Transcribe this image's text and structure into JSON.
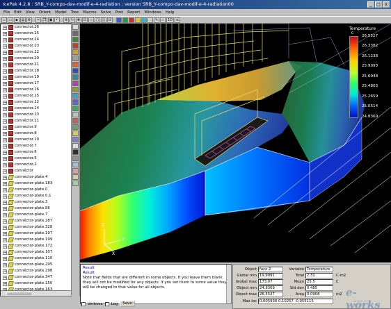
{
  "window": {
    "title": "IcePak 4.2.8 : SRB_Y-compo-dav-modif-e-4-radiation ; version SRB_Y-compo-dav-modif-e-4-radiation00",
    "minimize": "_",
    "maximize": "□",
    "close": "x"
  },
  "menu": [
    "File",
    "Edit",
    "View",
    "Orient",
    "Model",
    "Tree",
    "Macros",
    "Solve",
    "Post",
    "Report",
    "Windows",
    "Help"
  ],
  "toolbar": {
    "icons": [
      "new-file-icon",
      "open-icon",
      "save-icon",
      "print-icon",
      "settings-icon",
      "cut-icon",
      "copy-icon",
      "paste-icon",
      "undo-icon",
      "zoom-icon",
      "rotate-icon",
      "pan-icon",
      "fit-icon",
      "iso-view-icon",
      "front-view-icon",
      "side-view-icon",
      "top-view-icon",
      "grid-icon",
      "mesh-icon",
      "solve-icon",
      "contour-icon",
      "vector-icon",
      "particle-icon",
      "probe-icon",
      "plane-icon",
      "report-icon"
    ],
    "label_1d": "1D"
  },
  "tree": {
    "items": [
      {
        "label": "connector.26",
        "type": "connector"
      },
      {
        "label": "connector.25",
        "type": "connector"
      },
      {
        "label": "connector.24",
        "type": "connector"
      },
      {
        "label": "connector.23",
        "type": "connector"
      },
      {
        "label": "connector.22",
        "type": "connector"
      },
      {
        "label": "connector.20",
        "type": "connector"
      },
      {
        "label": "connector.21",
        "type": "connector"
      },
      {
        "label": "connector.18",
        "type": "connector"
      },
      {
        "label": "connector.19",
        "type": "connector"
      },
      {
        "label": "connector.17",
        "type": "connector"
      },
      {
        "label": "connector.16",
        "type": "connector"
      },
      {
        "label": "connector.15",
        "type": "connector"
      },
      {
        "label": "connector.12",
        "type": "connector"
      },
      {
        "label": "connector.14",
        "type": "connector"
      },
      {
        "label": "connector.13",
        "type": "connector"
      },
      {
        "label": "connector.11",
        "type": "connector"
      },
      {
        "label": "connector.9",
        "type": "connector"
      },
      {
        "label": "connector.8",
        "type": "connector"
      },
      {
        "label": "connector.10",
        "type": "connector"
      },
      {
        "label": "connector.7",
        "type": "connector"
      },
      {
        "label": "connector.6",
        "type": "connector"
      },
      {
        "label": "connector.5",
        "type": "connector"
      },
      {
        "label": "connector.2",
        "type": "connector"
      },
      {
        "label": "connector",
        "type": "connector"
      },
      {
        "label": "connector-plate.4",
        "type": "plate"
      },
      {
        "label": "connector-plate.183",
        "type": "plate"
      },
      {
        "label": "connector-plate.0",
        "type": "plate"
      },
      {
        "label": "connector-plate.0.1",
        "type": "plate"
      },
      {
        "label": "connector-plate.3",
        "type": "plate"
      },
      {
        "label": "connector-plate.56",
        "type": "plate"
      },
      {
        "label": "connector-plate.7",
        "type": "plate"
      },
      {
        "label": "connector-plate.287",
        "type": "plate"
      },
      {
        "label": "connector-plate.328",
        "type": "plate"
      },
      {
        "label": "connector-plate.197",
        "type": "plate"
      },
      {
        "label": "connector-plate.199",
        "type": "plate"
      },
      {
        "label": "connector-plate.172",
        "type": "plate"
      },
      {
        "label": "connector-plate.107",
        "type": "plate"
      },
      {
        "label": "connector-plate.110",
        "type": "plate"
      },
      {
        "label": "connector-plate.295",
        "type": "plate"
      },
      {
        "label": "connector-plate.298",
        "type": "plate"
      },
      {
        "label": "connector-plate.347",
        "type": "plate"
      },
      {
        "label": "connector-plate.150",
        "type": "plate"
      },
      {
        "label": "connector-plate.163",
        "type": "plate"
      },
      {
        "label": "connector-plate.97",
        "type": "plate"
      }
    ]
  },
  "viewport": {
    "legend": {
      "title": "Temperature",
      "unit": "C",
      "values": [
        "26.5527",
        "26.3382",
        "26.1238",
        "25.9093",
        "25.6948",
        "25.4803",
        "25.2659",
        "25.0514",
        "24.8369"
      ]
    },
    "axes": {
      "z": "Z",
      "y": "Y",
      "x": "X"
    }
  },
  "result": {
    "heading": "Result",
    "title": "Result",
    "message": "Note that fields that are different in some objects. If you leave them blank they will not be modified for any objects. If you set them to some value they will be changed to that value for all objects.",
    "verbose_label": "Verbose",
    "log_label": "Log",
    "save_label": "Save"
  },
  "object_info": {
    "object_label": "Object",
    "object_value": "face 2",
    "variable_label": "Variable",
    "variable_value": "Temperature",
    "global_min_label": "Global min",
    "global_min_value": "19.9991",
    "total_label": "Total",
    "total_value": "2.31",
    "total_unit": "C-m2",
    "global_max_label": "Global max",
    "global_max_value": "173.07",
    "mean_label": "Mean",
    "mean_value": "25.5",
    "mean_unit": "C",
    "object_min_label": "Object min",
    "object_min_value": "24.8369",
    "std_dev_label": "Std dev",
    "std_dev_value": "0.485",
    "object_max_label": "Object max",
    "object_max_value": "26.5527",
    "area_label": "Area",
    "area_value": "0.0908",
    "area_unit": "m2",
    "max_loc_label": "Max loc",
    "max_loc_value": "0.005938 0.10257 -0.055115"
  },
  "watermark": {
    "brand": "e-works",
    "sub": "www.e-works.net.cn"
  }
}
